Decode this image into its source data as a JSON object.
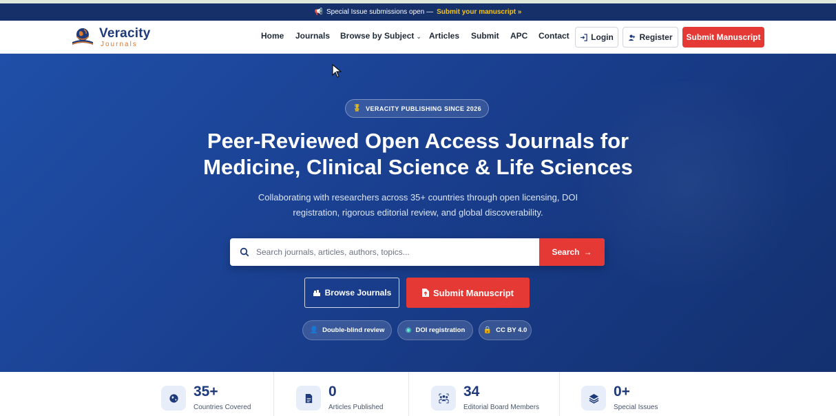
{
  "announcement": {
    "text": "Special Issue submissions open —",
    "link": "Submit your manuscript »",
    "icon": "megaphone-icon"
  },
  "brand": {
    "name": "Veracity",
    "tagline": "Journals"
  },
  "nav": {
    "home": "Home",
    "journals": "Journals",
    "browse": "Browse by Subject",
    "articles": "Articles",
    "submit": "Submit",
    "apc": "APC",
    "contact": "Contact",
    "login": "Login",
    "register": "Register",
    "submit_manuscript": "Submit Manuscript"
  },
  "hero": {
    "badge": "VERACITY PUBLISHING SINCE 2026",
    "title_line1": "Peer-Reviewed Open Access Journals for",
    "title_line2": "Medicine, Clinical Science & Life Sciences",
    "subtitle_line1": "Collaborating with researchers across 35+ countries through open licensing, DOI",
    "subtitle_line2": "registration, rigorous editorial review, and global discoverability.",
    "search_placeholder": "Search journals, articles, authors, topics...",
    "search_value": "",
    "search_button": "Search",
    "browse_button": "Browse Journals",
    "submit_button": "Submit Manuscript",
    "pills": [
      "Double-blind review",
      "DOI registration",
      "CC BY 4.0"
    ]
  },
  "stats": [
    {
      "value": "35+",
      "label": "Countries Covered",
      "icon": "globe-icon"
    },
    {
      "value": "0",
      "label": "Articles Published",
      "icon": "document-icon"
    },
    {
      "value": "34",
      "label": "Editorial Board Members",
      "icon": "users-icon"
    },
    {
      "value": "0+",
      "label": "Special Issues",
      "icon": "layers-icon"
    }
  ],
  "colors": {
    "brand_navy": "#1e3a7b",
    "accent_red": "#e53935",
    "announce_bg": "#16306a",
    "highlight_yellow": "#f5c518",
    "logo_orange": "#e0782b"
  }
}
